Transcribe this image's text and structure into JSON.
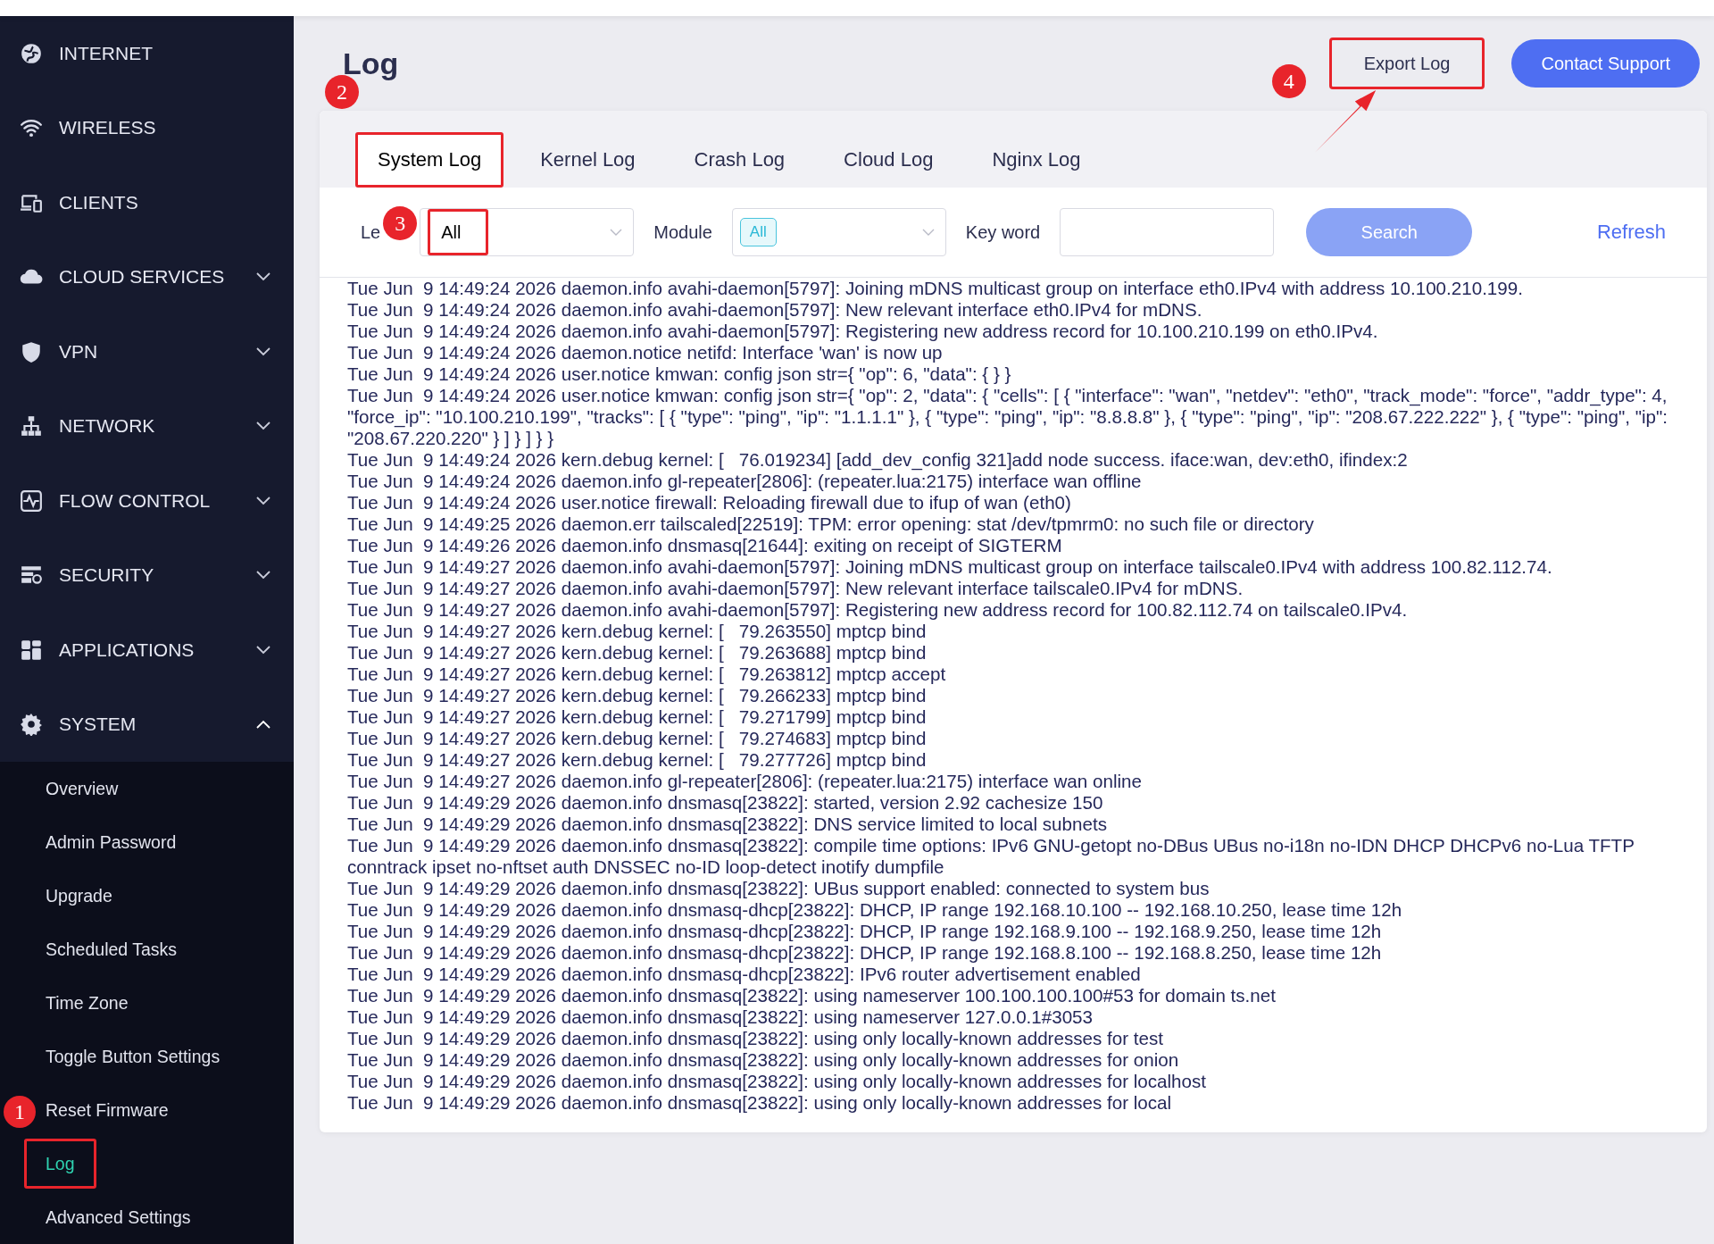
{
  "sidebar": {
    "items": [
      {
        "label": "INTERNET",
        "kind": "link"
      },
      {
        "label": "WIRELESS",
        "kind": "link"
      },
      {
        "label": "CLIENTS",
        "kind": "link"
      },
      {
        "label": "CLOUD SERVICES",
        "kind": "group",
        "expanded": false
      },
      {
        "label": "VPN",
        "kind": "group",
        "expanded": false
      },
      {
        "label": "NETWORK",
        "kind": "group",
        "expanded": false
      },
      {
        "label": "FLOW CONTROL",
        "kind": "group",
        "expanded": false
      },
      {
        "label": "SECURITY",
        "kind": "group",
        "expanded": false
      },
      {
        "label": "APPLICATIONS",
        "kind": "group",
        "expanded": false
      },
      {
        "label": "SYSTEM",
        "kind": "group",
        "expanded": true
      }
    ],
    "submenu": [
      {
        "label": "Overview",
        "selected": false,
        "highlighted": false
      },
      {
        "label": "Admin Password",
        "selected": false,
        "highlighted": false
      },
      {
        "label": "Upgrade",
        "selected": false,
        "highlighted": false
      },
      {
        "label": "Scheduled Tasks",
        "selected": false,
        "highlighted": false
      },
      {
        "label": "Time Zone",
        "selected": false,
        "highlighted": false
      },
      {
        "label": "Toggle Button Settings",
        "selected": false,
        "highlighted": false
      },
      {
        "label": "Reset Firmware",
        "selected": false,
        "highlighted": false
      },
      {
        "label": "Log",
        "selected": true,
        "highlighted": true,
        "marker": "1"
      },
      {
        "label": "Advanced Settings",
        "selected": false,
        "highlighted": false
      }
    ]
  },
  "page": {
    "title": "Log",
    "export_button": {
      "label": "Export Log",
      "highlighted": true,
      "marker": "4",
      "arrow": true
    },
    "support_button": "Contact Support"
  },
  "tabs": [
    {
      "label": "System Log",
      "selected": true,
      "highlighted": true,
      "marker": "2"
    },
    {
      "label": "Kernel Log",
      "selected": false,
      "highlighted": false
    },
    {
      "label": "Crash Log",
      "selected": false,
      "highlighted": false
    },
    {
      "label": "Cloud Log",
      "selected": false,
      "highlighted": false
    },
    {
      "label": "Nginx Log",
      "selected": false,
      "highlighted": false
    }
  ],
  "filters": {
    "level_label": "Le",
    "level": {
      "value": "All",
      "highlighted": true,
      "marker": "3"
    },
    "module_label": "Module",
    "module_tag": "All",
    "keyword_label": "Key word",
    "search": "Search",
    "refresh": "Refresh"
  },
  "log_lines": [
    "Tue Jun  9 14:49:24 2026 daemon.info avahi-daemon[5797]: Joining mDNS multicast group on interface eth0.IPv4 with address 10.100.210.199.",
    "Tue Jun  9 14:49:24 2026 daemon.info avahi-daemon[5797]: New relevant interface eth0.IPv4 for mDNS.",
    "Tue Jun  9 14:49:24 2026 daemon.info avahi-daemon[5797]: Registering new address record for 10.100.210.199 on eth0.IPv4.",
    "Tue Jun  9 14:49:24 2026 daemon.notice netifd: Interface 'wan' is now up",
    "Tue Jun  9 14:49:24 2026 user.notice kmwan: config json str={ \"op\": 6, \"data\": { } }",
    "Tue Jun  9 14:49:24 2026 user.notice kmwan: config json str={ \"op\": 2, \"data\": { \"cells\": [ { \"interface\": \"wan\", \"netdev\": \"eth0\", \"track_mode\": \"force\", \"addr_type\": 4, \"force_ip\": \"10.100.210.199\", \"tracks\": [ { \"type\": \"ping\", \"ip\": \"1.1.1.1\" }, { \"type\": \"ping\", \"ip\": \"8.8.8.8\" }, { \"type\": \"ping\", \"ip\": \"208.67.222.222\" }, { \"type\": \"ping\", \"ip\": \"208.67.220.220\" } ] } ] } }",
    "Tue Jun  9 14:49:24 2026 kern.debug kernel: [   76.019234] [add_dev_config 321]add node success. iface:wan, dev:eth0, ifindex:2",
    "Tue Jun  9 14:49:24 2026 daemon.info gl-repeater[2806]: (repeater.lua:2175) interface wan offline",
    "Tue Jun  9 14:49:24 2026 user.notice firewall: Reloading firewall due to ifup of wan (eth0)",
    "Tue Jun  9 14:49:25 2026 daemon.err tailscaled[22519]: TPM: error opening: stat /dev/tpmrm0: no such file or directory",
    "Tue Jun  9 14:49:26 2026 daemon.info dnsmasq[21644]: exiting on receipt of SIGTERM",
    "Tue Jun  9 14:49:27 2026 daemon.info avahi-daemon[5797]: Joining mDNS multicast group on interface tailscale0.IPv4 with address 100.82.112.74.",
    "Tue Jun  9 14:49:27 2026 daemon.info avahi-daemon[5797]: New relevant interface tailscale0.IPv4 for mDNS.",
    "Tue Jun  9 14:49:27 2026 daemon.info avahi-daemon[5797]: Registering new address record for 100.82.112.74 on tailscale0.IPv4.",
    "Tue Jun  9 14:49:27 2026 kern.debug kernel: [   79.263550] mptcp bind",
    "Tue Jun  9 14:49:27 2026 kern.debug kernel: [   79.263688] mptcp bind",
    "Tue Jun  9 14:49:27 2026 kern.debug kernel: [   79.263812] mptcp accept",
    "Tue Jun  9 14:49:27 2026 kern.debug kernel: [   79.266233] mptcp bind",
    "Tue Jun  9 14:49:27 2026 kern.debug kernel: [   79.271799] mptcp bind",
    "Tue Jun  9 14:49:27 2026 kern.debug kernel: [   79.274683] mptcp bind",
    "Tue Jun  9 14:49:27 2026 kern.debug kernel: [   79.277726] mptcp bind",
    "Tue Jun  9 14:49:27 2026 daemon.info gl-repeater[2806]: (repeater.lua:2175) interface wan online",
    "Tue Jun  9 14:49:29 2026 daemon.info dnsmasq[23822]: started, version 2.92 cachesize 150",
    "Tue Jun  9 14:49:29 2026 daemon.info dnsmasq[23822]: DNS service limited to local subnets",
    "Tue Jun  9 14:49:29 2026 daemon.info dnsmasq[23822]: compile time options: IPv6 GNU-getopt no-DBus UBus no-i18n no-IDN DHCP DHCPv6 no-Lua TFTP conntrack ipset no-nftset auth DNSSEC no-ID loop-detect inotify dumpfile",
    "Tue Jun  9 14:49:29 2026 daemon.info dnsmasq[23822]: UBus support enabled: connected to system bus",
    "Tue Jun  9 14:49:29 2026 daemon.info dnsmasq-dhcp[23822]: DHCP, IP range 192.168.10.100 -- 192.168.10.250, lease time 12h",
    "Tue Jun  9 14:49:29 2026 daemon.info dnsmasq-dhcp[23822]: DHCP, IP range 192.168.9.100 -- 192.168.9.250, lease time 12h",
    "Tue Jun  9 14:49:29 2026 daemon.info dnsmasq-dhcp[23822]: DHCP, IP range 192.168.8.100 -- 192.168.8.250, lease time 12h",
    "Tue Jun  9 14:49:29 2026 daemon.info dnsmasq-dhcp[23822]: IPv6 router advertisement enabled",
    "Tue Jun  9 14:49:29 2026 daemon.info dnsmasq[23822]: using nameserver 100.100.100.100#53 for domain ts.net",
    "Tue Jun  9 14:49:29 2026 daemon.info dnsmasq[23822]: using nameserver 127.0.0.1#3053",
    "Tue Jun  9 14:49:29 2026 daemon.info dnsmasq[23822]: using only locally-known addresses for test",
    "Tue Jun  9 14:49:29 2026 daemon.info dnsmasq[23822]: using only locally-known addresses for onion",
    "Tue Jun  9 14:49:29 2026 daemon.info dnsmasq[23822]: using only locally-known addresses for localhost",
    "Tue Jun  9 14:49:29 2026 daemon.info dnsmasq[23822]: using only locally-known addresses for local"
  ]
}
